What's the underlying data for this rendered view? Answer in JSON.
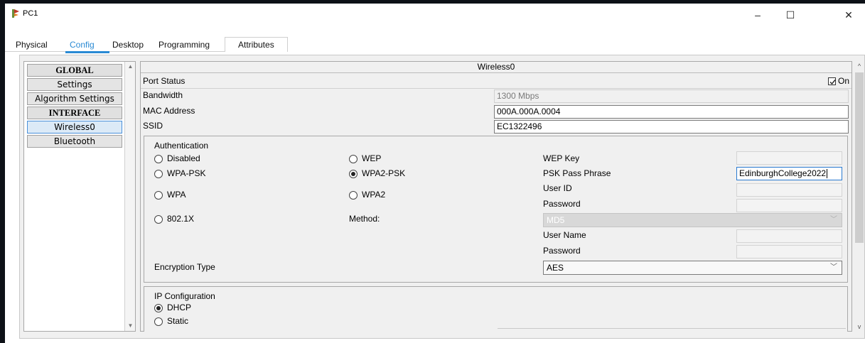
{
  "window": {
    "title": "PC1",
    "minimize": "–",
    "maximize": "☐",
    "close": "✕"
  },
  "tabs": [
    "Physical",
    "Config",
    "Desktop",
    "Programming",
    "Attributes"
  ],
  "active_tab": "Config",
  "nav": {
    "items": [
      {
        "label": "GLOBAL",
        "header": true
      },
      {
        "label": "Settings"
      },
      {
        "label": "Algorithm Settings"
      },
      {
        "label": "INTERFACE",
        "header": true
      },
      {
        "label": "Wireless0",
        "selected": true
      },
      {
        "label": "Bluetooth"
      }
    ]
  },
  "content": {
    "title": "Wireless0",
    "port_status_label": "Port Status",
    "port_on_label": "On",
    "port_on_checked": true,
    "bandwidth_label": "Bandwidth",
    "bandwidth_value": "1300 Mbps",
    "mac_label": "MAC Address",
    "mac_value": "000A.000A.0004",
    "ssid_label": "SSID",
    "ssid_value": "EC1322496"
  },
  "auth": {
    "title": "Authentication",
    "options": {
      "disabled": "Disabled",
      "wep": "WEP",
      "wpa_psk": "WPA-PSK",
      "wpa2_psk": "WPA2-PSK",
      "wpa": "WPA",
      "wpa2": "WPA2",
      "dot1x": "802.1X"
    },
    "selected": "wpa2_psk",
    "wep_key_label": "WEP Key",
    "psk_label": "PSK Pass Phrase",
    "psk_value": "EdinburghCollege2022",
    "user_id_label": "User ID",
    "password_label": "Password",
    "method_label": "Method:",
    "method_value": "MD5",
    "user_name_label": "User Name",
    "password2_label": "Password",
    "encryption_label": "Encryption Type",
    "encryption_value": "AES"
  },
  "ip": {
    "title": "IP Configuration",
    "dhcp": "DHCP",
    "static": "Static",
    "selected": "dhcp"
  }
}
